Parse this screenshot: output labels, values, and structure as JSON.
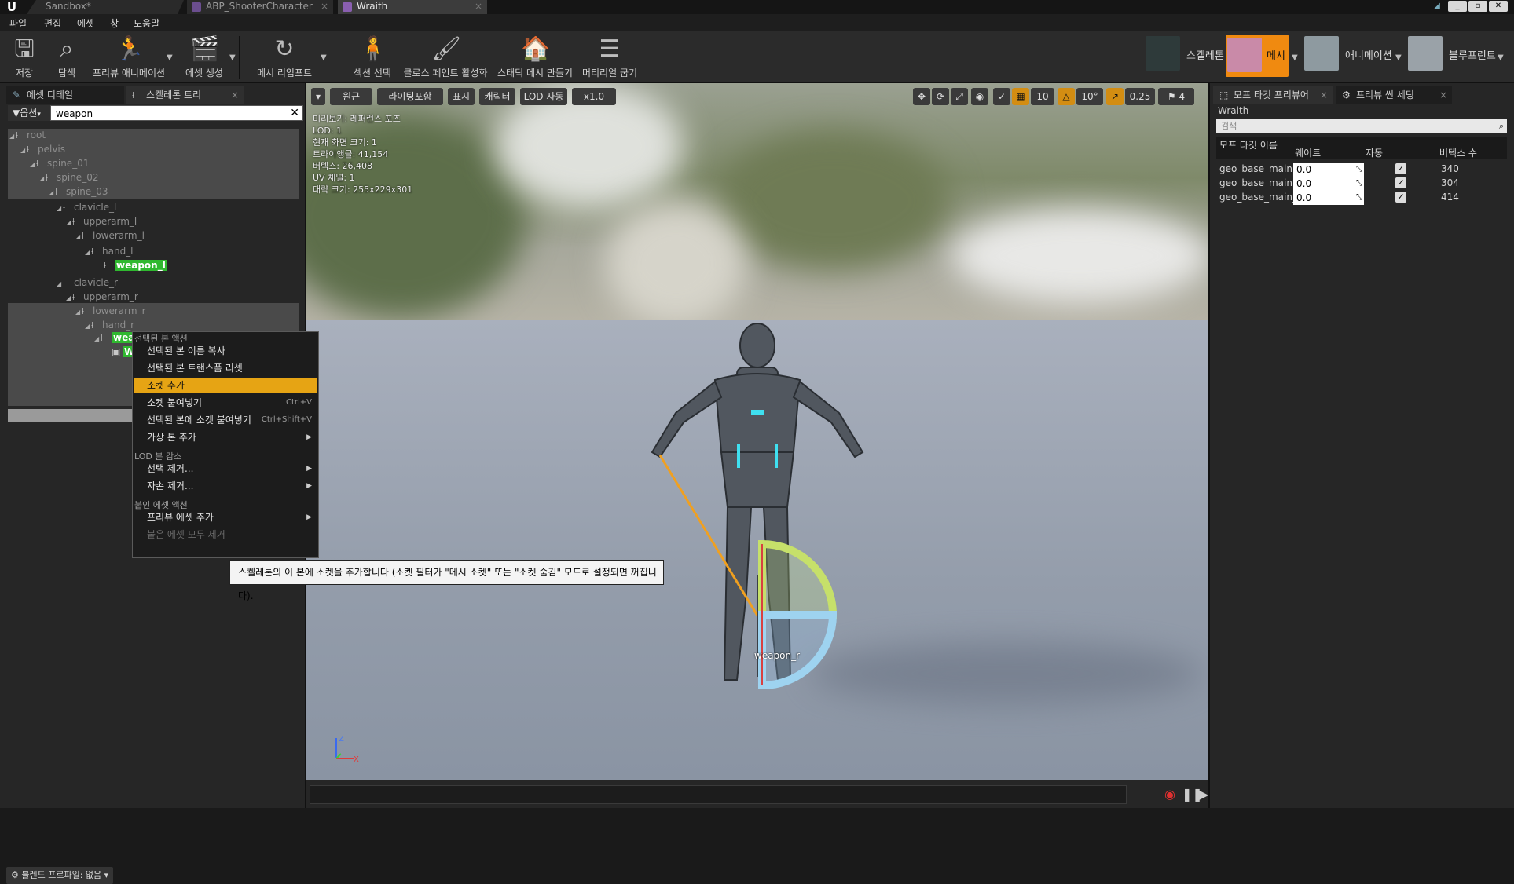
{
  "titlebar": {
    "tabs": [
      {
        "label": "Sandbox*"
      },
      {
        "label": "ABP_ShooterCharacter"
      },
      {
        "label": "Wraith"
      }
    ]
  },
  "menubar": {
    "items": [
      "파일",
      "편집",
      "에셋",
      "창",
      "도움말"
    ]
  },
  "toolbar": {
    "save": "저장",
    "browse": "탐색",
    "preview_anim": "프리뷰 애니메이션",
    "create_asset": "에셋 생성",
    "mesh_reimport": "메시 리임포트",
    "section_select": "섹션 선택",
    "cloth_paint": "클로스 페인트 활성화",
    "make_static_mesh": "스태틱 메시 만들기",
    "bake_materials": "머티리얼 굽기",
    "modes": [
      {
        "label": "스켈레톤"
      },
      {
        "label": "메시"
      },
      {
        "label": "애니메이션"
      },
      {
        "label": "블루프린트"
      }
    ]
  },
  "left_panel": {
    "tabs": [
      {
        "label": "에셋 디테일"
      },
      {
        "label": "스켈레톤 트리"
      }
    ],
    "options_label": "옵션",
    "search_value": "weapon",
    "tree": [
      {
        "label": "root"
      },
      {
        "label": "pelvis"
      },
      {
        "label": "spine_01"
      },
      {
        "label": "spine_02"
      },
      {
        "label": "spine_03"
      },
      {
        "label": "clavicle_l"
      },
      {
        "label": "upperarm_l"
      },
      {
        "label": "lowerarm_l"
      },
      {
        "label": "hand_l"
      },
      {
        "label": "weapon_l"
      },
      {
        "label": "clavicle_r"
      },
      {
        "label": "upperarm_r"
      },
      {
        "label": "lowerarm_r"
      },
      {
        "label": "hand_r"
      },
      {
        "label": "weapon_r"
      },
      {
        "label": "Weapon"
      }
    ],
    "blend_profile": "블렌드 프로파일: 없음"
  },
  "viewport": {
    "toolbar": {
      "perspective": "원근",
      "lighting": "라이팅포함",
      "show": "표시",
      "character": "캐릭터",
      "lod": "LOD 자동",
      "speed": "x1.0",
      "grid_snap": "10",
      "rot_snap": "10°",
      "scale_snap": "0.25",
      "cam_speed": "4"
    },
    "stats": [
      "미리보기: 레퍼런스 포즈",
      "LOD: 1",
      "현재 화면 크기: 1",
      "트라이앵글: 41,154",
      "버텍스: 26,408",
      "UV 채널: 1",
      "대략 크기: 255x229x301"
    ],
    "bone_label": "weapon_r",
    "axis": {
      "z": "Z",
      "x": "X"
    }
  },
  "context_menu": {
    "sections": [
      {
        "title": "선택된 본 액션"
      },
      {
        "title": "LOD 본 감소"
      },
      {
        "title": "붙인 에셋 액션"
      }
    ],
    "items": [
      {
        "label": "선택된 본 이름 복사",
        "shortcut": ""
      },
      {
        "label": "선택된 본 트랜스폼 리셋",
        "shortcut": ""
      },
      {
        "label": "소켓 추가",
        "shortcut": ""
      },
      {
        "label": "소켓 붙여넣기",
        "shortcut": "Ctrl+V"
      },
      {
        "label": "선택된 본에 소켓 붙여넣기",
        "shortcut": "Ctrl+Shift+V"
      },
      {
        "label": "가상 본 추가",
        "shortcut": ""
      },
      {
        "label": "선택 제거...",
        "shortcut": ""
      },
      {
        "label": "자손 제거...",
        "shortcut": ""
      },
      {
        "label": "프리뷰 에셋 추가",
        "shortcut": ""
      },
      {
        "label": "붙은 에셋 모두 제거",
        "shortcut": ""
      }
    ],
    "tooltip": "스켈레톤의 이 본에 소켓을 추가합니다 (소켓 필터가 \"메시 소켓\" 또는 \"소켓 숨김\" 모드로 설정되면 꺼집니다)."
  },
  "right_panel": {
    "tabs": [
      {
        "label": "모프 타깃 프리뷰어"
      },
      {
        "label": "프리뷰 씬 세팅"
      }
    ],
    "title": "Wraith",
    "search_placeholder": "검색",
    "columns": [
      "모프 타깃 이름",
      "웨이트",
      "자동",
      "버텍스 수"
    ],
    "rows": [
      {
        "name": "geo_base_main_geo",
        "weight": "0.0",
        "vertices": "340"
      },
      {
        "name": "geo_base_main_geo",
        "weight": "0.0",
        "vertices": "304"
      },
      {
        "name": "geo_base_main_geo",
        "weight": "0.0",
        "vertices": "414"
      }
    ]
  },
  "colors": {
    "accent": "#e6a414",
    "highlight_green": "#2fb82f"
  }
}
